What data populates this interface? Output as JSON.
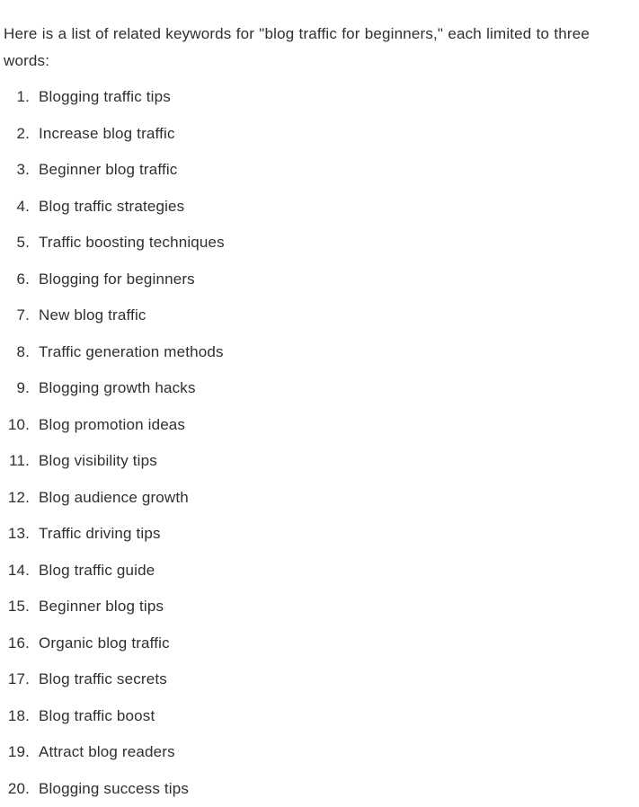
{
  "document": {
    "intro_paragraph": "Here is a list of related keywords for \"blog traffic for beginners,\" each limited to three words:",
    "list": {
      "type": "ordered-numeric",
      "items": [
        {
          "marker": "1.",
          "label": "Blogging traffic tips"
        },
        {
          "marker": "2.",
          "label": "Increase blog traffic"
        },
        {
          "marker": "3.",
          "label": "Beginner blog traffic"
        },
        {
          "marker": "4.",
          "label": "Blog traffic strategies"
        },
        {
          "marker": "5.",
          "label": "Traffic boosting techniques"
        },
        {
          "marker": "6.",
          "label": "Blogging for beginners"
        },
        {
          "marker": "7.",
          "label": "New blog traffic"
        },
        {
          "marker": "8.",
          "label": "Traffic generation methods"
        },
        {
          "marker": "9.",
          "label": "Blogging growth hacks"
        },
        {
          "marker": "10.",
          "label": "Blog promotion ideas"
        },
        {
          "marker": "11.",
          "label": "Blog visibility tips"
        },
        {
          "marker": "12.",
          "label": "Blog audience growth"
        },
        {
          "marker": "13.",
          "label": "Traffic driving tips"
        },
        {
          "marker": "14.",
          "label": "Blog traffic guide"
        },
        {
          "marker": "15.",
          "label": "Beginner blog tips"
        },
        {
          "marker": "16.",
          "label": "Organic blog traffic"
        },
        {
          "marker": "17.",
          "label": "Blog traffic secrets"
        },
        {
          "marker": "18.",
          "label": "Blog traffic boost"
        },
        {
          "marker": "19.",
          "label": "Attract blog readers"
        },
        {
          "marker": "20.",
          "label": "Blogging success tips"
        }
      ]
    }
  },
  "colors": {
    "text": "#2f2f2f",
    "background": "#ffffff"
  }
}
